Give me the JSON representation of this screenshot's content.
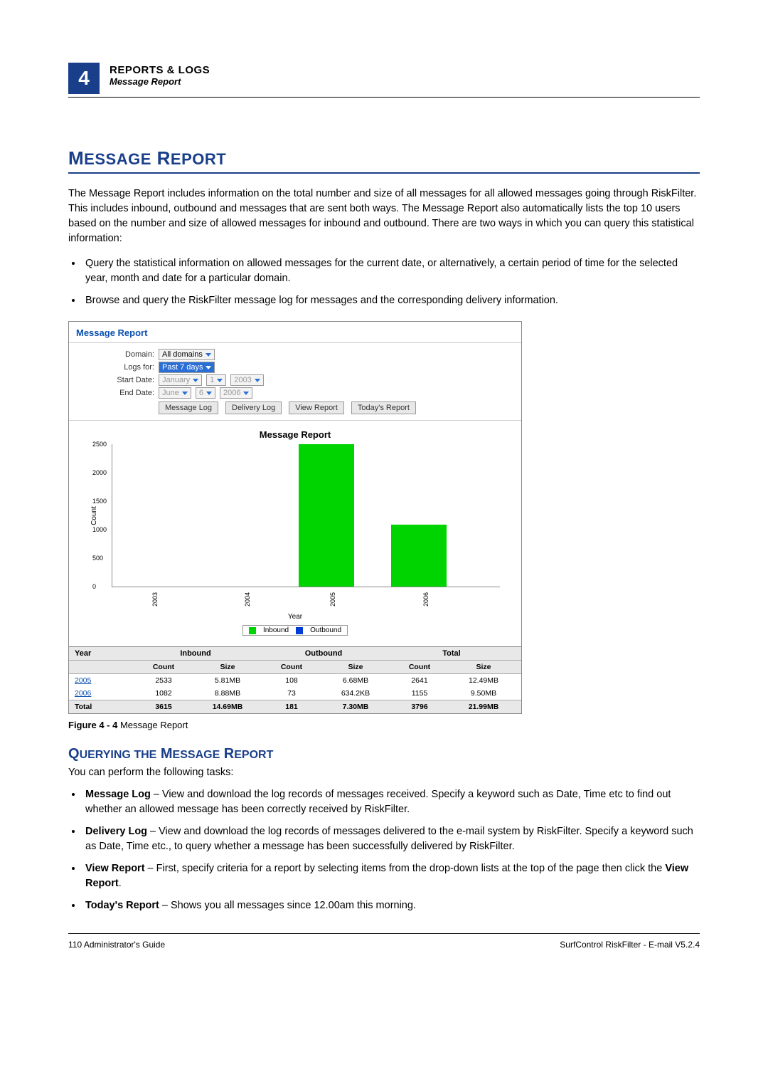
{
  "header": {
    "chapter_number": "4",
    "section": "REPORTS & LOGS",
    "subsection": "Message Report"
  },
  "title_caps_first": "M",
  "title_rest1": "ESSAGE",
  "title_caps_second": "R",
  "title_rest2": "EPORT",
  "intro": "The Message Report includes information on the total number and size of all messages for all allowed messages going through RiskFilter. This includes inbound, outbound and messages that are sent both ways. The Message Report also automatically lists the top 10 users based on the number and size of allowed messages for inbound and outbound. There are two ways in which you can query this statistical information:",
  "intro_bullets": [
    "Query the statistical information on allowed messages for the current date, or alternatively, a certain period of time for the selected year, month and date for a particular domain.",
    "Browse and query the RiskFilter message log for messages and the corresponding delivery information."
  ],
  "screenshot": {
    "panel_title": "Message Report",
    "filters": {
      "domain_label": "Domain:",
      "domain_value": "All domains",
      "logs_for_label": "Logs for:",
      "logs_for_value": "Past 7 days",
      "start_date_label": "Start Date:",
      "start_month": "January",
      "start_day": "1",
      "start_year": "2003",
      "end_date_label": "End Date:",
      "end_month": "June",
      "end_day": "6",
      "end_year": "2006"
    },
    "buttons": {
      "message_log": "Message Log",
      "delivery_log": "Delivery Log",
      "view_report": "View Report",
      "todays_report": "Today's Report"
    },
    "chart_title": "Message Report",
    "xlabel": "Year",
    "ylabel": "Count",
    "legend": {
      "inbound": "Inbound",
      "outbound": "Outbound"
    },
    "table": {
      "headers": {
        "year": "Year",
        "inbound": "Inbound",
        "outbound": "Outbound",
        "total": "Total",
        "count": "Count",
        "size": "Size"
      },
      "rows": [
        {
          "year": "2005",
          "in_count": "2533",
          "in_size": "5.81MB",
          "out_count": "108",
          "out_size": "6.68MB",
          "t_count": "2641",
          "t_size": "12.49MB"
        },
        {
          "year": "2006",
          "in_count": "1082",
          "in_size": "8.88MB",
          "out_count": "73",
          "out_size": "634.2KB",
          "t_count": "1155",
          "t_size": "9.50MB"
        }
      ],
      "total_label": "Total",
      "totals": {
        "in_count": "3615",
        "in_size": "14.69MB",
        "out_count": "181",
        "out_size": "7.30MB",
        "t_count": "3796",
        "t_size": "21.99MB"
      }
    }
  },
  "chart_data": {
    "type": "bar",
    "title": "Message Report",
    "xlabel": "Year",
    "ylabel": "Count",
    "ylim": [
      0,
      2500
    ],
    "yticks": [
      0,
      500,
      1000,
      1500,
      2000,
      2500
    ],
    "categories": [
      "2003",
      "2004",
      "2005",
      "2006"
    ],
    "series": [
      {
        "name": "Inbound",
        "color": "#00d400",
        "values": [
          0,
          0,
          2533,
          1082
        ]
      },
      {
        "name": "Outbound",
        "color": "#003bd4",
        "values": [
          0,
          0,
          108,
          73
        ]
      }
    ]
  },
  "figure_caption_bold": "Figure 4 - 4",
  "figure_caption_rest": " Message Report",
  "subheading": {
    "q": "Q",
    "uerying": "UERYING THE",
    "m": "M",
    "essage": "ESSAGE",
    "r": "R",
    "eport": "EPORT"
  },
  "tasks_intro": "You can perform the following tasks:",
  "tasks": [
    {
      "bold": "Message Log",
      "rest": " – View and download the log records of messages received. Specify a keyword such as Date, Time etc to find out whether an allowed message has been correctly received by RiskFilter."
    },
    {
      "bold": "Delivery Log",
      "rest": " – View and download the log records of messages delivered to the e-mail system by RiskFilter. Specify a keyword such as Date, Time etc., to query whether a message has been successfully delivered by RiskFilter."
    },
    {
      "bold": "View Report",
      "rest_before": " – First, specify criteria for a report by selecting items from the drop-down lists at the top of the page then click the ",
      "rest_bold": "View Report",
      "rest_after": "."
    },
    {
      "bold": "Today's Report",
      "rest": " – Shows you all messages since 12.00am this morning."
    }
  ],
  "footer": {
    "left_page": "110",
    "left_text": "  Administrator's Guide",
    "right": "SurfControl RiskFilter - E-mail V5.2.4"
  }
}
